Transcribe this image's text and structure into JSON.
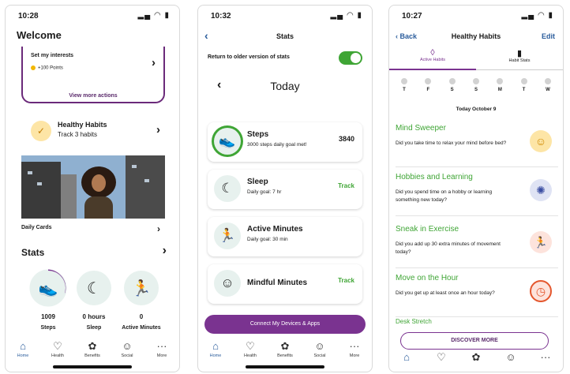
{
  "colors": {
    "accent_purple": "#7a3390",
    "green": "#3fa535",
    "link_blue": "#2b5d9c",
    "icon_bg": "#e7f1ee"
  },
  "screen1": {
    "time": "10:28",
    "title": "Welcome",
    "interests": "Set my interests",
    "points": "+100 Points",
    "view_more": "View more actions",
    "habits_title": "Healthy Habits",
    "habits_sub": "Track 3 habits",
    "daily_cards": "Daily Cards",
    "stats_title": "Stats",
    "stats": [
      {
        "value": "1009",
        "label": "Steps",
        "icon": "shoe-icon"
      },
      {
        "value": "0 hours",
        "label": "Sleep",
        "icon": "moon-icon"
      },
      {
        "value": "0",
        "label": "Active Minutes",
        "icon": "person-icon"
      }
    ],
    "tabs": [
      "Home",
      "Health",
      "Benefits",
      "Social",
      "More"
    ]
  },
  "screen2": {
    "time": "10:32",
    "title": "Stats",
    "older_toggle": "Return to older version of stats",
    "day": "Today",
    "cards": [
      {
        "name": "Steps",
        "goal": "3000 steps daily goal met!",
        "value": "3840"
      },
      {
        "name": "Sleep",
        "goal": "Daily goal: 7 hr",
        "value": "Track"
      },
      {
        "name": "Active Minutes",
        "goal": "Daily goal: 30 min",
        "value": ""
      },
      {
        "name": "Mindful Minutes",
        "goal": "",
        "value": "Track"
      }
    ],
    "connect": "Connect My Devices & Apps",
    "tabs": [
      "Home",
      "Health",
      "Benefits",
      "Social",
      "More"
    ]
  },
  "screen3": {
    "time": "10:27",
    "back": "Back",
    "title": "Healthy Habits",
    "edit": "Edit",
    "tab_active": "Active Habits",
    "tab_stats": "Habit Stats",
    "week": [
      "T",
      "F",
      "S",
      "S",
      "M",
      "T",
      "W"
    ],
    "today": "Today October 9",
    "habits": [
      {
        "name": "Mind Sweeper",
        "question": "Did you take time to relax your mind before bed?"
      },
      {
        "name": "Hobbies and Learning",
        "question": "Did you spend time on a hobby or learning something new today?"
      },
      {
        "name": "Sneak in Exercise",
        "question": "Did you add up 30 extra minutes of movement today?"
      },
      {
        "name": "Move on the Hour",
        "question": "Did you get up at least once an hour today?"
      }
    ],
    "partial": "Desk Stretch",
    "discover": "DISCOVER MORE"
  }
}
